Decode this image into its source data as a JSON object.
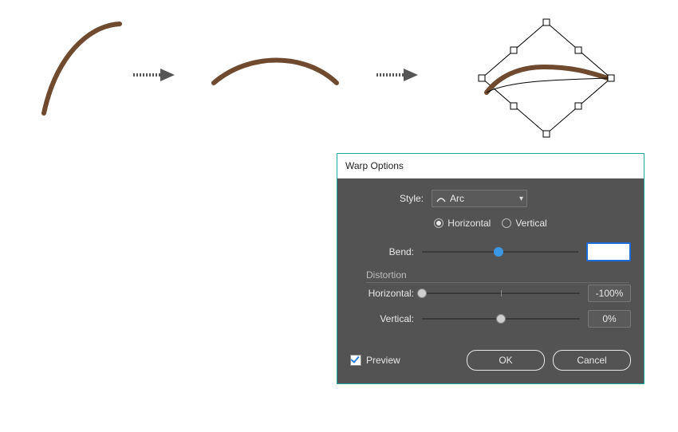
{
  "illustration": {
    "arrow1": true,
    "arrow2": true,
    "stroke_color": "#6f4a2f"
  },
  "dialog": {
    "title": "Warp Options",
    "style_label": "Style:",
    "style_value": "Arc",
    "orientation": {
      "horizontal_label": "Horizontal",
      "vertical_label": "Vertical",
      "selected": "horizontal"
    },
    "bend": {
      "label": "Bend:",
      "value": "",
      "pos_pct": 49
    },
    "distortion_label": "Distortion",
    "dist_h": {
      "label": "Horizontal:",
      "value": "-100%",
      "pos_pct": 0
    },
    "dist_v": {
      "label": "Vertical:",
      "value": "0%",
      "pos_pct": 50
    },
    "preview_label": "Preview",
    "preview_checked": true,
    "ok_label": "OK",
    "cancel_label": "Cancel"
  }
}
